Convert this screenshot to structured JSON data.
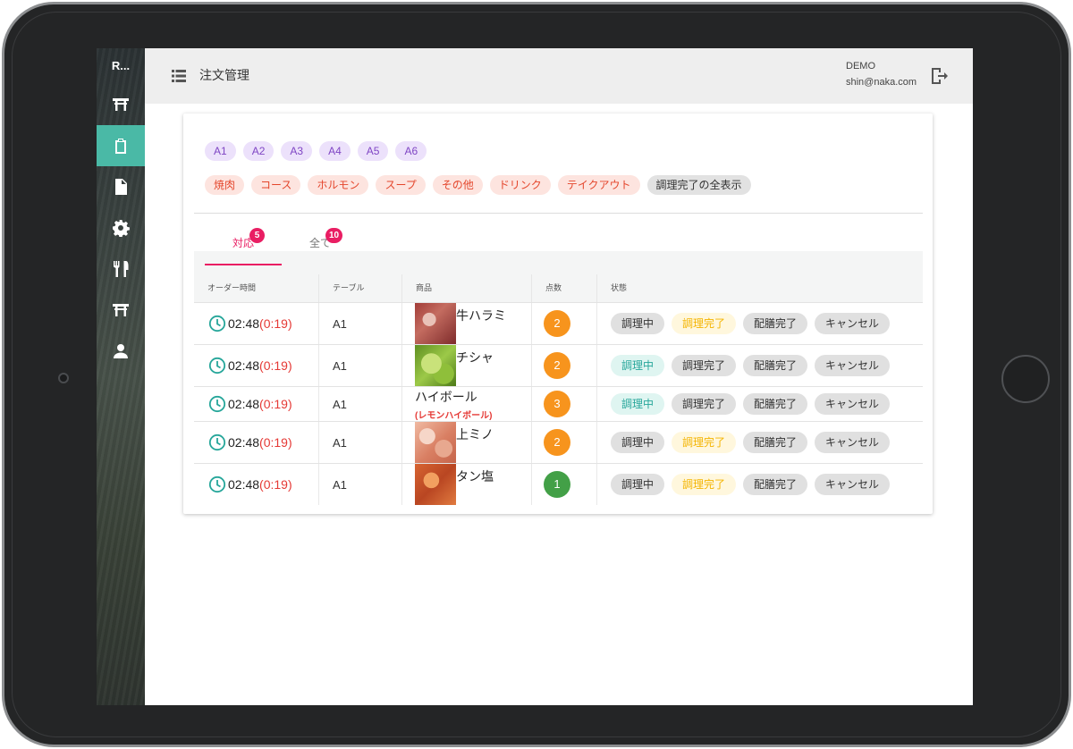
{
  "sidebar": {
    "logo": "R...",
    "items": [
      {
        "icon": "torii-gate-icon",
        "active": false
      },
      {
        "icon": "clipboard-icon",
        "active": true
      },
      {
        "icon": "document-icon",
        "active": false
      },
      {
        "icon": "gear-icon",
        "active": false
      },
      {
        "icon": "utensils-icon",
        "active": false
      },
      {
        "icon": "torii-gate-icon",
        "active": false
      },
      {
        "icon": "user-icon",
        "active": false
      }
    ],
    "active_color": "#4ab9a6"
  },
  "header": {
    "title": "注文管理",
    "user_name": "DEMO",
    "user_email": "shin@naka.com"
  },
  "filters": {
    "tables": [
      "A1",
      "A2",
      "A3",
      "A4",
      "A5",
      "A6"
    ],
    "categories": [
      "焼肉",
      "コース",
      "ホルモン",
      "スープ",
      "その他",
      "ドリンク",
      "テイクアウト"
    ],
    "show_completed": "調理完了の全表示"
  },
  "tabs": [
    {
      "label": "対応",
      "count": "5",
      "active": true
    },
    {
      "label": "全て",
      "count": "10",
      "active": false
    }
  ],
  "table": {
    "headers": [
      "オーダー時間",
      "テーブル",
      "商品",
      "点数",
      "状態"
    ],
    "status_labels": [
      "調理中",
      "調理完了",
      "配膳完了",
      "キャンセル"
    ],
    "rows": [
      {
        "time": "02:48",
        "elapsed": "(0:19)",
        "table": "A1",
        "product": "牛ハラミ",
        "product_sub": "",
        "image": "harami",
        "qty": "2",
        "qty_color": "#f7941d",
        "status": "調理完了"
      },
      {
        "time": "02:48",
        "elapsed": "(0:19)",
        "table": "A1",
        "product": "チシャ",
        "product_sub": "",
        "image": "chisha",
        "qty": "2",
        "qty_color": "#f7941d",
        "status": "調理中"
      },
      {
        "time": "02:48",
        "elapsed": "(0:19)",
        "table": "A1",
        "product": "ハイボール",
        "product_sub": "(レモンハイボール)",
        "image": "",
        "qty": "3",
        "qty_color": "#f7941d",
        "status": "調理中"
      },
      {
        "time": "02:48",
        "elapsed": "(0:19)",
        "table": "A1",
        "product": "上ミノ",
        "product_sub": "",
        "image": "mino",
        "qty": "2",
        "qty_color": "#f7941d",
        "status": "調理完了"
      },
      {
        "time": "02:48",
        "elapsed": "(0:19)",
        "table": "A1",
        "product": "タン塩",
        "product_sub": "",
        "image": "tan",
        "qty": "1",
        "qty_color": "#43a047",
        "status": "調理完了"
      }
    ]
  },
  "colors": {
    "accent_pink": "#e91e63",
    "elapsed_red": "#e53935",
    "cooking_teal": "#26a69a",
    "done_yellow": "#f4b400"
  }
}
